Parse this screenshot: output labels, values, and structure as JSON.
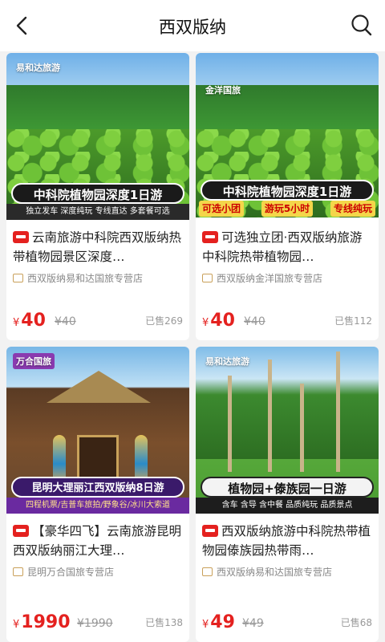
{
  "header": {
    "title": "西双版纳"
  },
  "products": [
    {
      "image_brand": "易和达旅游",
      "banner": "中科院植物园深度1日游",
      "subtags": "独立发车  深度纯玩  专线直达  多套餐可选",
      "title": "云南旅游中科院西双版纳热带植物园景区深度…",
      "store": "西双版纳易和达国旅专营店",
      "currency": "¥",
      "price": "40",
      "original_price": "¥40",
      "sold": "已售269"
    },
    {
      "image_brand": "金洋国旅",
      "banner": "中科院植物园深度1日游",
      "subtags": [
        "可选小团",
        "游玩5小时",
        "专线纯玩"
      ],
      "title": "可选独立团·西双版纳旅游中科院热带植物园…",
      "store": "西双版纳金洋国旅专营店",
      "currency": "¥",
      "price": "40",
      "original_price": "¥40",
      "sold": "已售112"
    },
    {
      "image_brand": "万合国旅",
      "banner": "昆明大理丽江西双版纳8日游",
      "subtags": "四程机票/吉普车旅拍/野象谷/冰川大索道",
      "title": "【豪华四飞】云南旅游昆明西双版纳丽江大理…",
      "store": "昆明万合国旅专营店",
      "currency": "¥",
      "price": "1990",
      "original_price": "¥1990",
      "sold": "已售138"
    },
    {
      "image_brand": "易和达旅游",
      "banner": "植物园+傣族园一日游",
      "subtags": "含车  含导  含中餐  品质纯玩  品质景点",
      "title": "西双版纳旅游中科院热带植物园傣族园热带雨…",
      "store": "西双版纳易和达国旅专营店",
      "currency": "¥",
      "price": "49",
      "original_price": "¥49",
      "sold": "已售68"
    }
  ],
  "icons": {
    "back": "chevron-left-icon",
    "search": "search-icon",
    "platform": "tmall-icon",
    "store": "store-icon"
  },
  "colors": {
    "price": "#e4211f",
    "background": "#f2f2f2"
  }
}
